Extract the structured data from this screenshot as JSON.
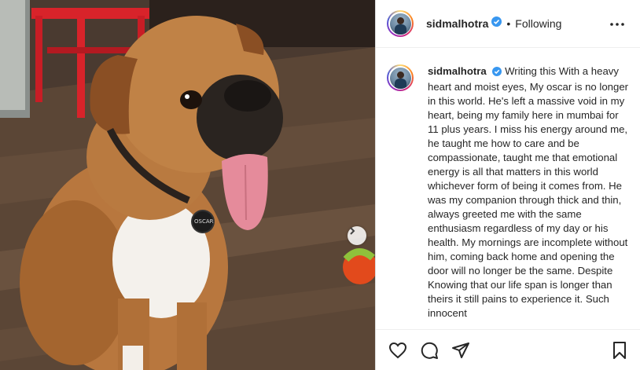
{
  "post": {
    "username": "sidmalhotra",
    "separator": "•",
    "follow_status": "Following",
    "caption_username": "sidmalhotra",
    "caption": "Writing this With a heavy heart and moist eyes, My oscar is no longer in this world. He's left a massive void in my heart, being my family here in mumbai for 11 plus years. I miss his energy around me, he taught me how to care and be compassionate, taught me that emotional energy is all that matters in this world whichever form of being it comes from. He was my companion through thick and thin, always greeted me with the same enthusiasm regardless of my day or his health. My mornings are incomplete without him, coming back home and opening the door will no longer be the same. Despite Knowing that our life span is longer than theirs it still pains to experience it. Such innocent"
  },
  "photo": {
    "tag_text": "OSCAR"
  },
  "colors": {
    "verified": "#3897f0",
    "text": "#262626",
    "border": "#dbdbdb"
  },
  "icons": {
    "like": "heart-icon",
    "comment": "comment-icon",
    "share": "share-icon",
    "save": "bookmark-icon",
    "more": "more-icon",
    "next": "chevron-right-icon"
  }
}
